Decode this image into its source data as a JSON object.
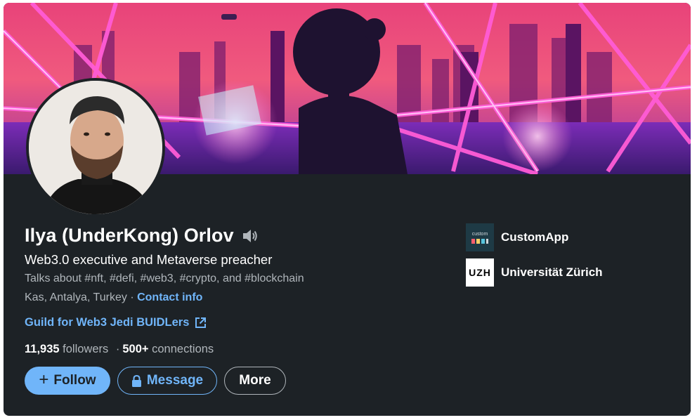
{
  "profile": {
    "name": "Ilya (UnderKong) Orlov",
    "headline": "Web3.0 executive and Metaverse preacher",
    "talks_about": "Talks about #nft, #defi, #web3, #crypto, and #blockchain",
    "location": "Kas, Antalya, Turkey",
    "location_separator": "·",
    "contact_label": "Contact info",
    "website_label": "Guild for Web3 Jedi BUIDLers",
    "followers_count": "11,935",
    "followers_label": "followers",
    "stats_separator": "·",
    "connections_count": "500+",
    "connections_label": "connections"
  },
  "actions": {
    "follow_icon": "+",
    "follow_label": "Follow",
    "message_label": "Message",
    "more_label": "More"
  },
  "experience": [
    {
      "name": "CustomApp",
      "logo": "customapp-logo",
      "logo_text": "custom app"
    },
    {
      "name": "Universität Zürich",
      "logo": "uzh-logo",
      "logo_text": "UZH"
    }
  ],
  "colors": {
    "card_bg": "#1d2226",
    "link_blue": "#70b5f9",
    "text_secondary": "#b0b6bb"
  }
}
